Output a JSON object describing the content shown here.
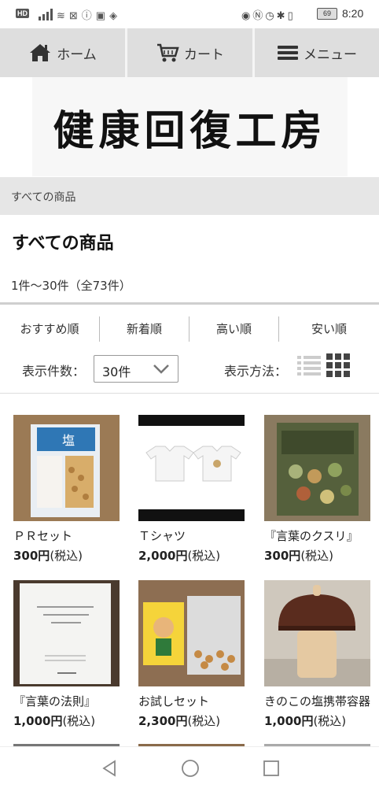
{
  "status_bar": {
    "hd_badge": "HD",
    "battery": "69",
    "time": "8:20"
  },
  "nav": {
    "home": "ホーム",
    "cart": "カート",
    "menu": "メニュー"
  },
  "logo_text": "健康回復工房",
  "breadcrumb": "すべての商品",
  "page_title": "すべての商品",
  "result_count": "1件～30件（全73件）",
  "sort_options": [
    "おすすめ順",
    "新着順",
    "高い順",
    "安い順"
  ],
  "display_count": {
    "label": "表示件数：",
    "value": "30件"
  },
  "display_method": {
    "label": "表示方法："
  },
  "products": [
    {
      "name": "ＰＲセット",
      "price": "300円",
      "tax": "(税込)"
    },
    {
      "name": "Ｔシャツ",
      "price": "2,000円",
      "tax": "(税込)"
    },
    {
      "name": "『言葉のクスリ』",
      "price": "300円",
      "tax": "(税込)"
    },
    {
      "name": "『言葉の法則』",
      "price": "1,000円",
      "tax": "(税込)"
    },
    {
      "name": "お試しセット",
      "price": "2,300円",
      "tax": "(税込)"
    },
    {
      "name": "きのこの塩携帯容器",
      "price": "1,000円",
      "tax": "(税込)"
    }
  ],
  "icons": {
    "home": "home-icon",
    "cart": "cart-icon",
    "menu": "hamburger-icon",
    "list_view": "list-view-icon",
    "grid_view": "grid-view-icon",
    "back": "back-triangle-icon",
    "home_circle": "home-circle-icon",
    "recents": "recents-square-icon"
  },
  "colors": {
    "nav_bg": "#dedede",
    "breadcrumb_bg": "#e6e6e6",
    "text": "#222222"
  }
}
